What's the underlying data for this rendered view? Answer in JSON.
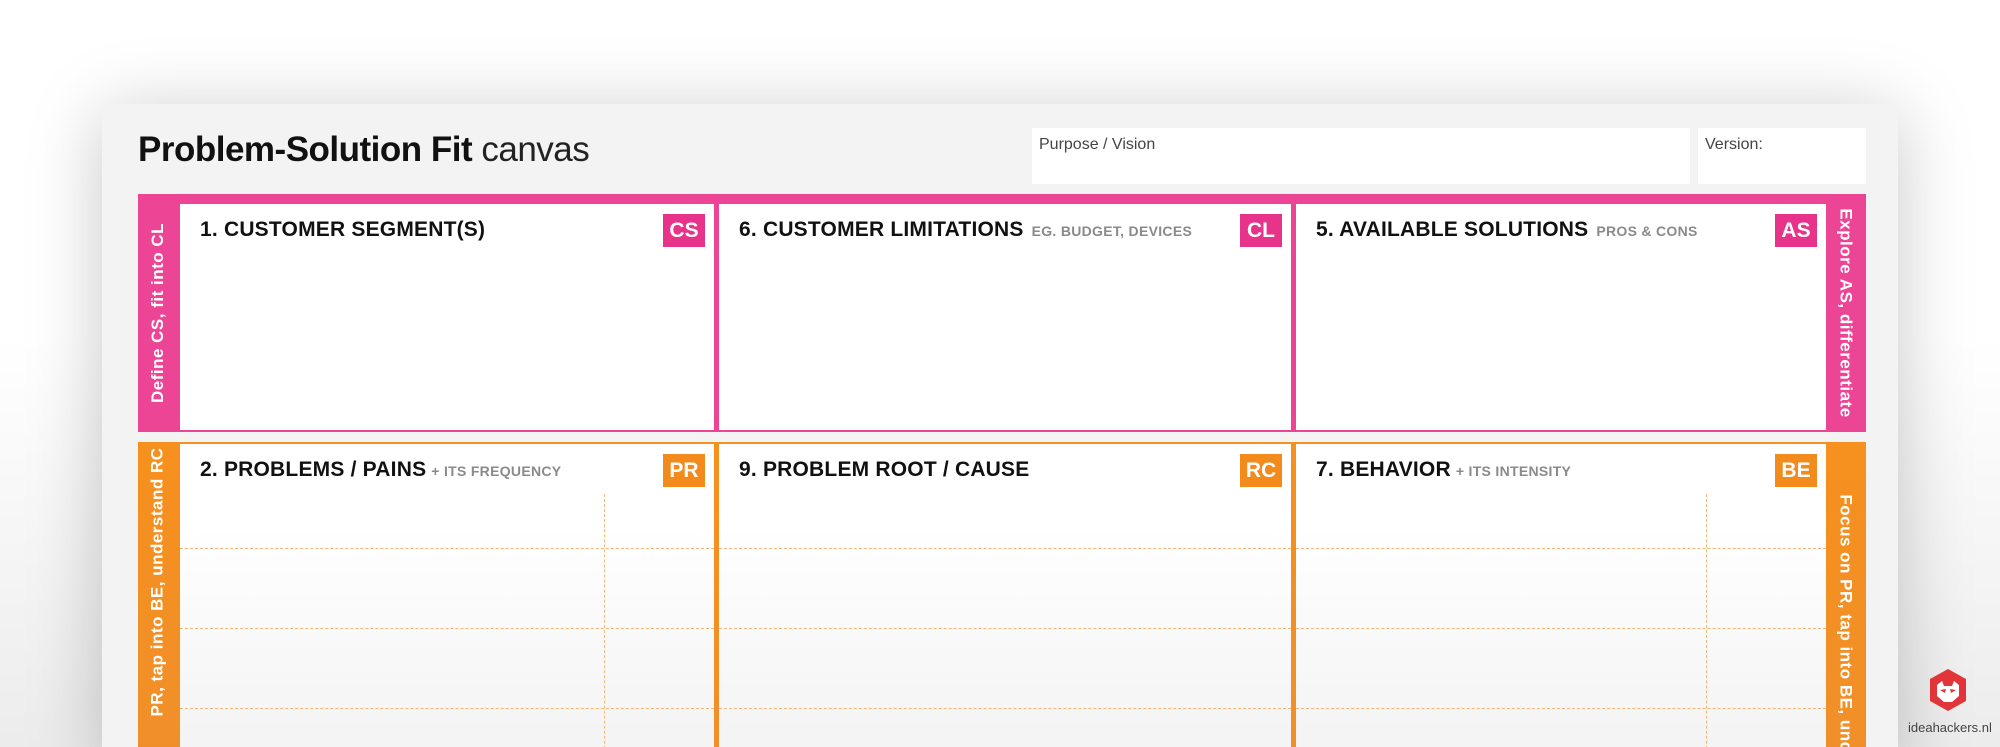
{
  "canvas": {
    "title_bold": "Problem-Solution Fit",
    "title_light": "canvas",
    "purpose_label": "Purpose / Vision",
    "version_label": "Version:"
  },
  "side_labels": {
    "pink_left": "Define CS, fit into CL",
    "pink_right": "Explore AS, differentiate",
    "orange_left": "PR, tap into BE, understand RC",
    "orange_right": "Focus on PR, tap into BE, under"
  },
  "boxes": {
    "cs": {
      "title": "1. CUSTOMER SEGMENT(S)",
      "sub": "",
      "badge": "CS"
    },
    "cl": {
      "title": "6. CUSTOMER LIMITATIONS",
      "sub": "EG. BUDGET, DEVICES",
      "badge": "CL"
    },
    "as": {
      "title": "5. AVAILABLE SOLUTIONS",
      "sub": "PROS & CONS",
      "badge": "AS"
    },
    "pr": {
      "title": "2. PROBLEMS / PAINS",
      "sub": "+ ITS FREQUENCY",
      "badge": "PR"
    },
    "rc": {
      "title": "9. PROBLEM ROOT / CAUSE",
      "sub": "",
      "badge": "RC"
    },
    "be": {
      "title": "7. BEHAVIOR",
      "sub": "+ ITS INTENSITY",
      "badge": "BE"
    }
  },
  "colors": {
    "pink": "#ec4596",
    "orange": "#f6901e",
    "logo_red": "#e2353a"
  },
  "logo": {
    "icon": "hacker-mask-icon",
    "text": "ideahackers.nl"
  }
}
